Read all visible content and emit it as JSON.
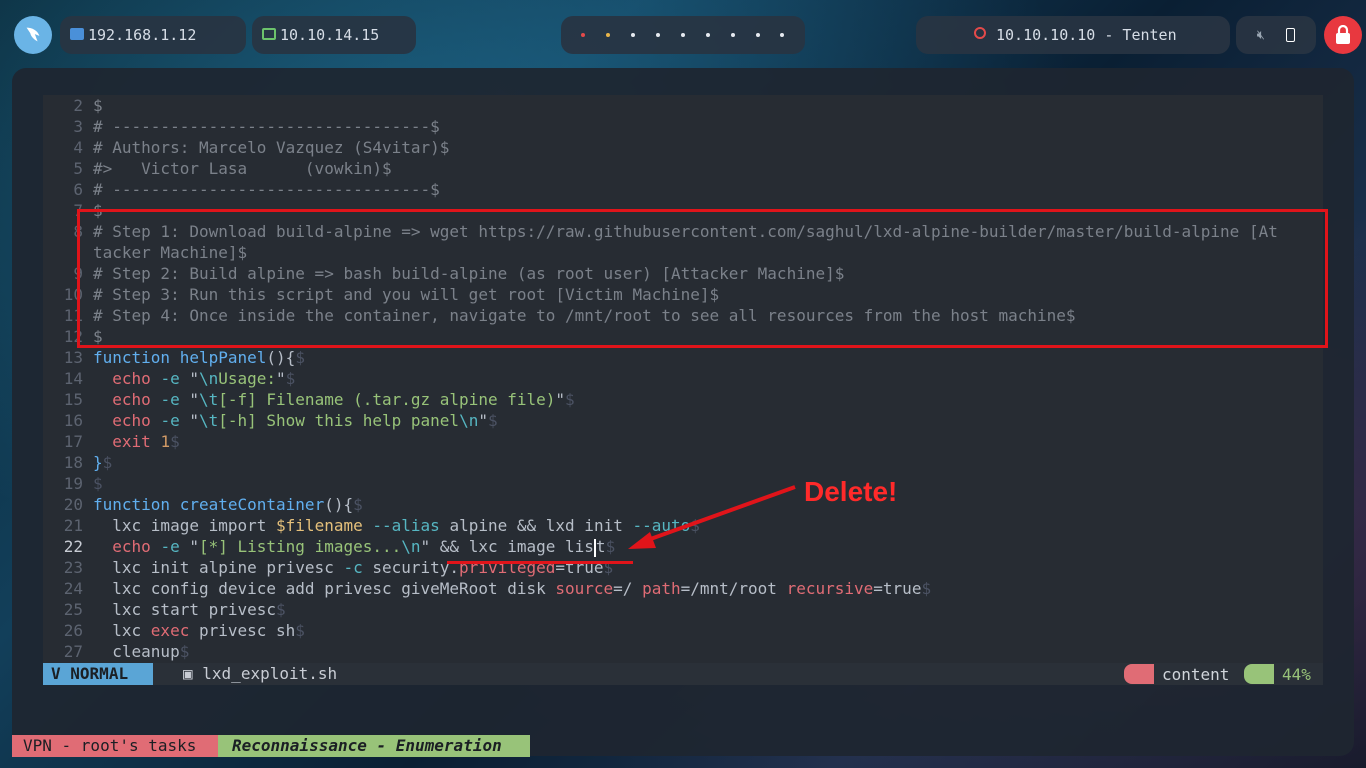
{
  "topbar": {
    "ip_local": "192.168.1.12",
    "ip_vpn": "10.10.14.15",
    "target": "10.10.10.10 - Tenten"
  },
  "editor": {
    "lines": [
      {
        "n": "2",
        "t": "$"
      },
      {
        "n": "3",
        "t": "# ---------------------------------$"
      },
      {
        "n": "4",
        "t": "# Authors: Marcelo Vazquez (S4vitar)$"
      },
      {
        "n": "5",
        "t": "#>   Victor Lasa      (vowkin)$"
      },
      {
        "n": "6",
        "t": "# ---------------------------------$"
      },
      {
        "n": "7",
        "t": "$"
      },
      {
        "n": "8",
        "t": "# Step 1: Download build-alpine => wget https://raw.githubusercontent.com/saghul/lxd-alpine-builder/master/build-alpine [At"
      },
      {
        "n": "",
        "t": "tacker Machine]$"
      },
      {
        "n": "9",
        "t": "# Step 2: Build alpine => bash build-alpine (as root user) [Attacker Machine]$"
      },
      {
        "n": "10",
        "t": "# Step 3: Run this script and you will get root [Victim Machine]$"
      },
      {
        "n": "11",
        "t": "# Step 4: Once inside the container, navigate to /mnt/root to see all resources from the host machine$"
      },
      {
        "n": "12",
        "t": "$"
      }
    ],
    "ln": [
      "13",
      "14",
      "15",
      "16",
      "17",
      "18",
      "19",
      "20",
      "21",
      "22",
      "23",
      "24",
      "25",
      "26",
      "27"
    ]
  },
  "status": {
    "mode": "NORMAL",
    "filename": "lxd_exploit.sh",
    "dir": "content",
    "percent": "44%"
  },
  "tmux": {
    "session": "VPN - root's tasks",
    "window": "Reconnaissance - Enumeration"
  },
  "annotation": {
    "label": "Delete!"
  }
}
